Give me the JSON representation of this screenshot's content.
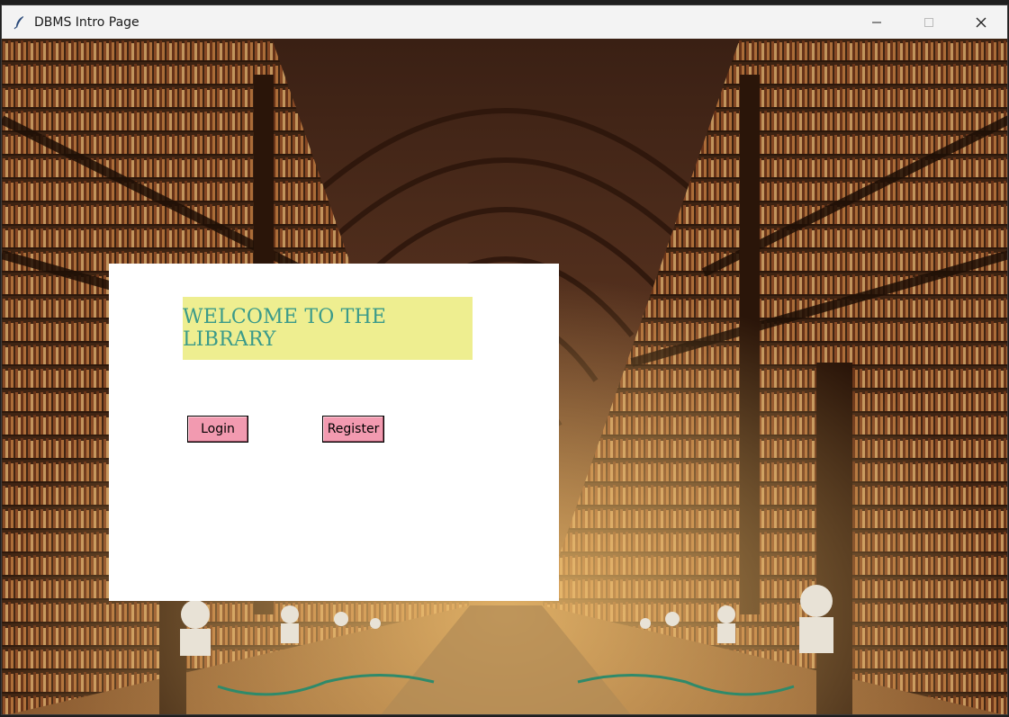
{
  "window": {
    "title": "DBMS Intro Page",
    "controls": {
      "minimize": "minimize-icon",
      "maximize": "maximize-icon",
      "close": "close-icon"
    }
  },
  "panel": {
    "heading": "WELCOME TO THE LIBRARY",
    "login_label": "Login",
    "register_label": "Register"
  },
  "colors": {
    "banner_bg": "#eeee90",
    "banner_text": "#3a9a8a",
    "button_bg": "#f29ab0"
  }
}
